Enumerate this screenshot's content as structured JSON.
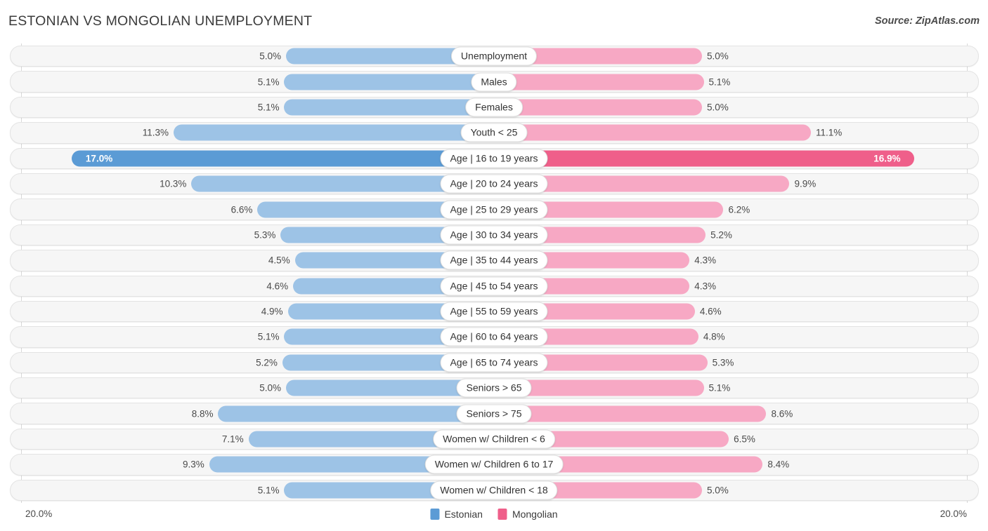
{
  "header": {
    "title": "ESTONIAN VS MONGOLIAN UNEMPLOYMENT",
    "source": "Source: ZipAtlas.com"
  },
  "legend": {
    "items": [
      {
        "label": "Estonian",
        "color": "#5b9bd5"
      },
      {
        "label": "Mongolian",
        "color": "#ef5f8a"
      }
    ]
  },
  "axis": {
    "min_label": "20.0%",
    "max_label": "20.0%"
  },
  "colors": {
    "left_normal": "#9dc3e6",
    "left_max": "#5b9bd5",
    "right_normal": "#f7a8c4",
    "right_max": "#ef5f8a",
    "track": "#f6f6f6",
    "gridline": "#d8d8d8"
  },
  "chart_data": {
    "type": "bar",
    "title": "ESTONIAN VS MONGOLIAN UNEMPLOYMENT",
    "subtitle": "",
    "orientation": "horizontal-diverging",
    "xlabel": "",
    "ylabel": "",
    "xlim": [
      20.0,
      20.0
    ],
    "grid": true,
    "legend_position": "bottom-center",
    "unit": "%",
    "categories": [
      "Unemployment",
      "Males",
      "Females",
      "Youth < 25",
      "Age | 16 to 19 years",
      "Age | 20 to 24 years",
      "Age | 25 to 29 years",
      "Age | 30 to 34 years",
      "Age | 35 to 44 years",
      "Age | 45 to 54 years",
      "Age | 55 to 59 years",
      "Age | 60 to 64 years",
      "Age | 65 to 74 years",
      "Seniors > 65",
      "Seniors > 75",
      "Women w/ Children < 6",
      "Women w/ Children 6 to 17",
      "Women w/ Children < 18"
    ],
    "series": [
      {
        "name": "Estonian",
        "values": [
          5.0,
          5.1,
          5.1,
          11.3,
          17.0,
          10.3,
          6.6,
          5.3,
          4.5,
          4.6,
          4.9,
          5.1,
          5.2,
          5.0,
          8.8,
          7.1,
          9.3,
          5.1
        ],
        "labels": [
          "5.0%",
          "5.1%",
          "5.1%",
          "11.3%",
          "17.0%",
          "10.3%",
          "6.6%",
          "5.3%",
          "4.5%",
          "4.6%",
          "4.9%",
          "5.1%",
          "5.2%",
          "5.0%",
          "8.8%",
          "7.1%",
          "9.3%",
          "5.1%"
        ]
      },
      {
        "name": "Mongolian",
        "values": [
          5.0,
          5.1,
          5.0,
          11.1,
          16.9,
          9.9,
          6.2,
          5.2,
          4.3,
          4.3,
          4.6,
          4.8,
          5.3,
          5.1,
          8.6,
          6.5,
          8.4,
          5.0
        ],
        "labels": [
          "5.0%",
          "5.1%",
          "5.0%",
          "11.1%",
          "16.9%",
          "9.9%",
          "6.2%",
          "5.2%",
          "4.3%",
          "4.3%",
          "4.6%",
          "4.8%",
          "5.3%",
          "5.1%",
          "8.6%",
          "6.5%",
          "8.4%",
          "5.0%"
        ]
      }
    ]
  }
}
